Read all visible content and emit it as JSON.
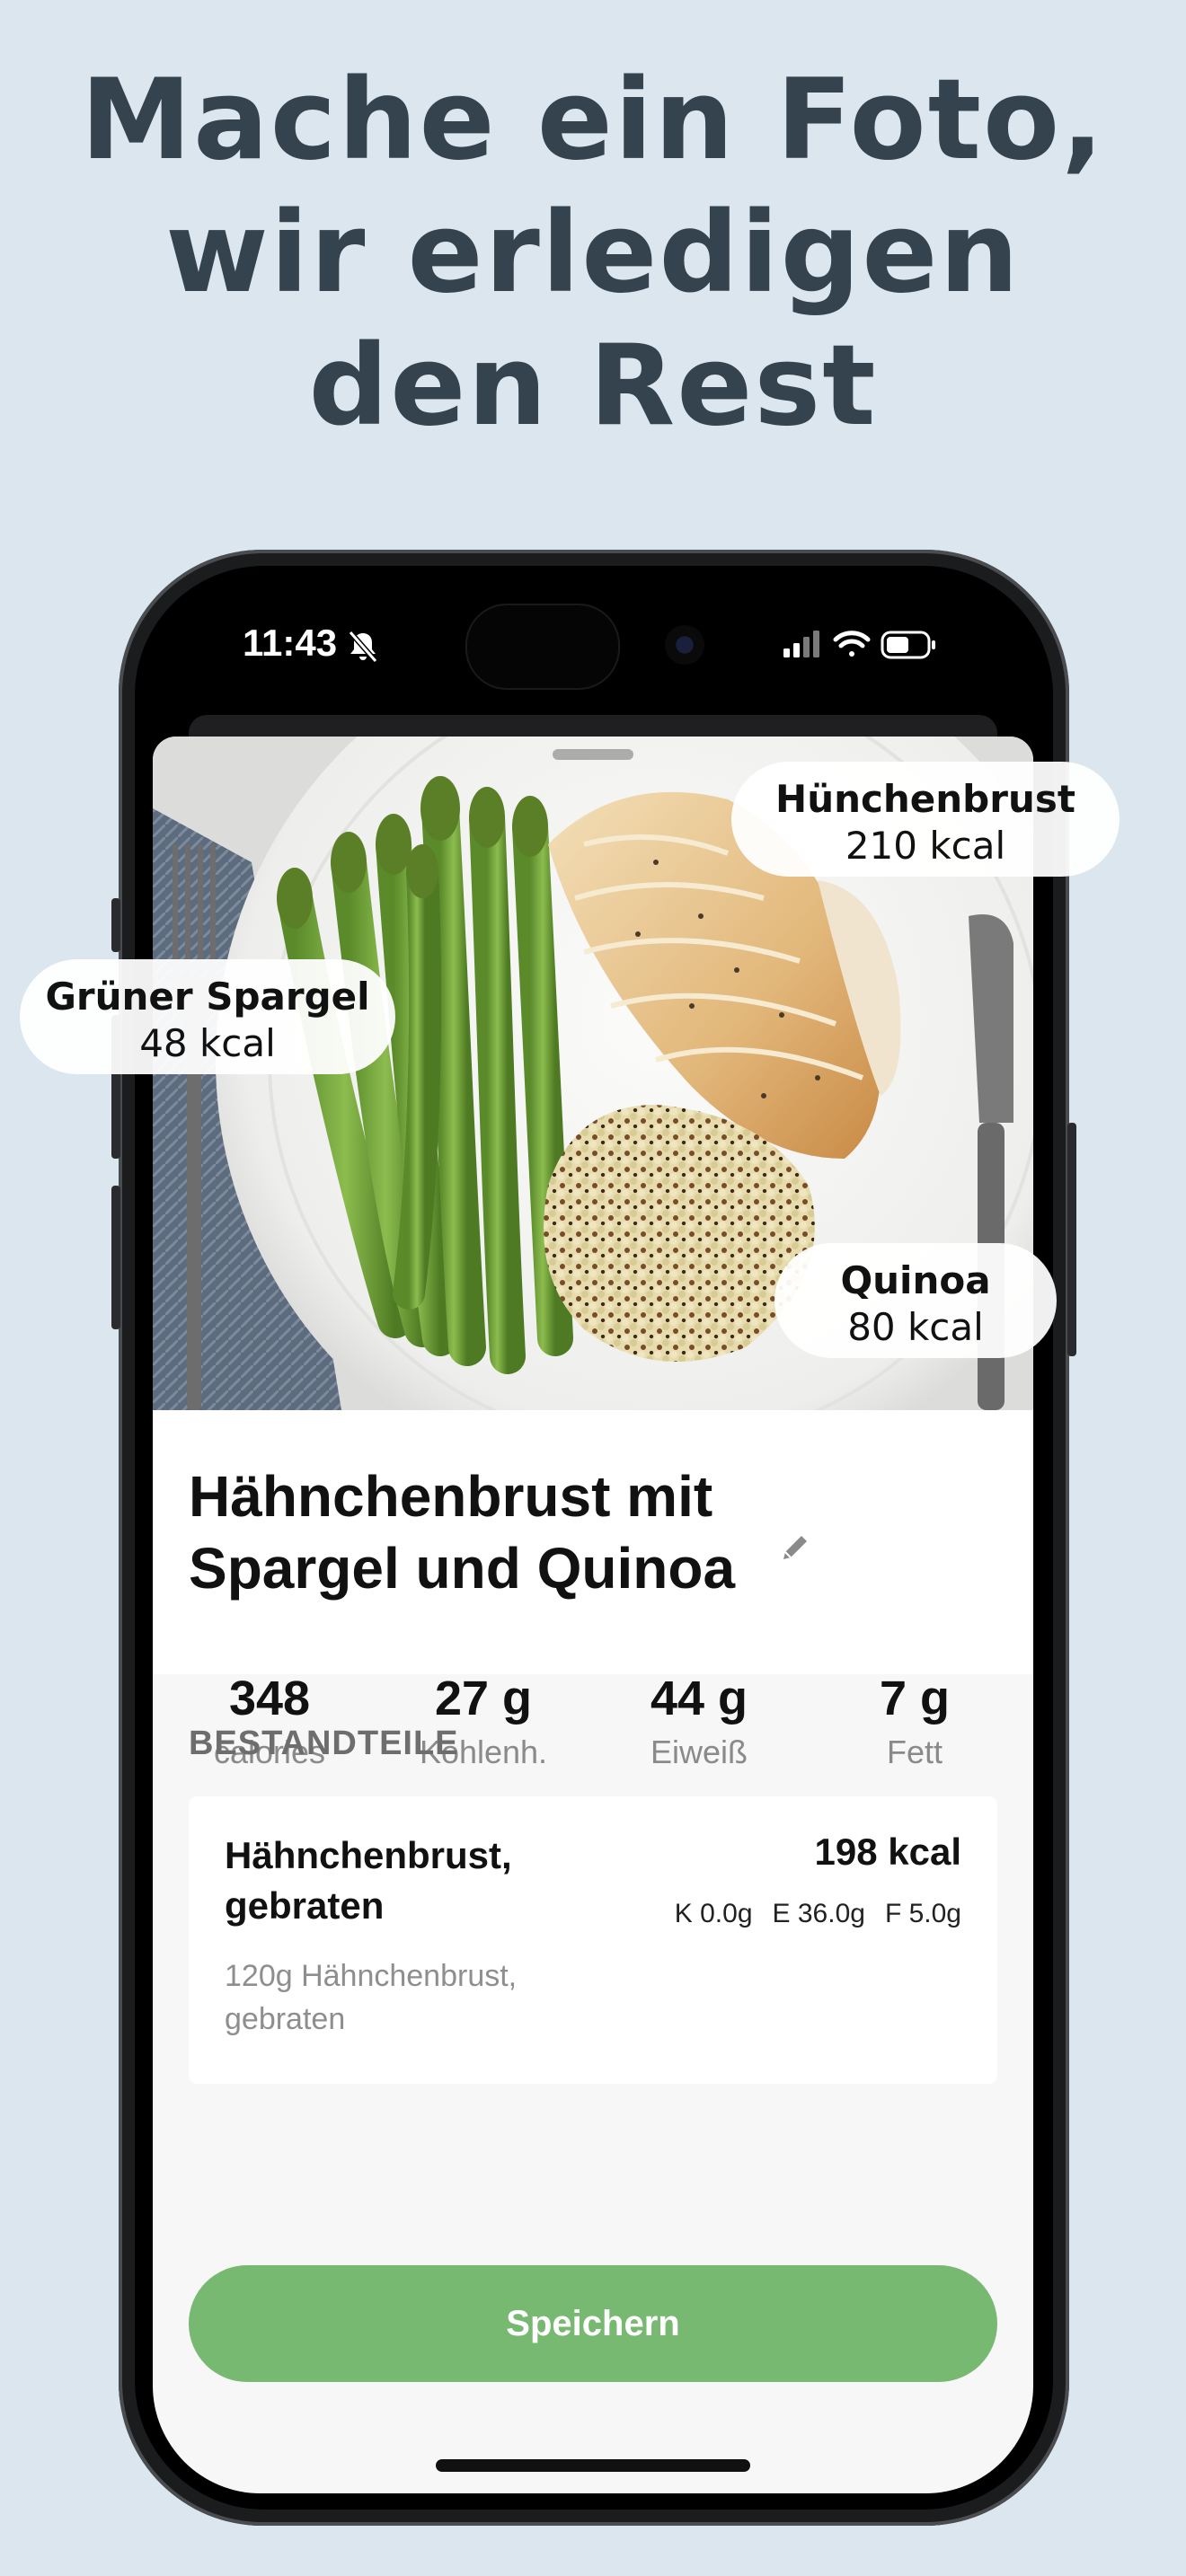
{
  "headline": [
    "Mache ein Foto,",
    "wir erledigen",
    "den Rest"
  ],
  "status_bar": {
    "time": "11:43"
  },
  "meal": {
    "title_line1": "Hähnchenbrust mit",
    "title_line2": "Spargel und Quinoa"
  },
  "food_labels": [
    {
      "name": "Hünchenbrust",
      "kcal": "210 kcal"
    },
    {
      "name": "Grüner Spargel",
      "kcal": "48 kcal"
    },
    {
      "name": "Quinoa",
      "kcal": "80 kcal"
    }
  ],
  "macros": [
    {
      "value": "348",
      "label": "calories"
    },
    {
      "value": "27 g",
      "label": "Kohlenh."
    },
    {
      "value": "44 g",
      "label": "Eiweiß"
    },
    {
      "value": "7 g",
      "label": "Fett"
    }
  ],
  "ingredients_section": {
    "heading": "BESTANDTEILE",
    "items": [
      {
        "name": "Hähnchenbrust, gebraten",
        "kcal": "198 kcal",
        "carbs": "K 0.0g",
        "protein": "E 36.0g",
        "fat": "F 5.0g",
        "description": "120g Hähnchenbrust, gebraten"
      }
    ]
  },
  "save_button": {
    "label": "Speichern",
    "color": "#78b972"
  },
  "icons": [
    "bell-slash-icon",
    "signal-icon",
    "wifi-icon",
    "battery-icon",
    "pencil-icon"
  ]
}
